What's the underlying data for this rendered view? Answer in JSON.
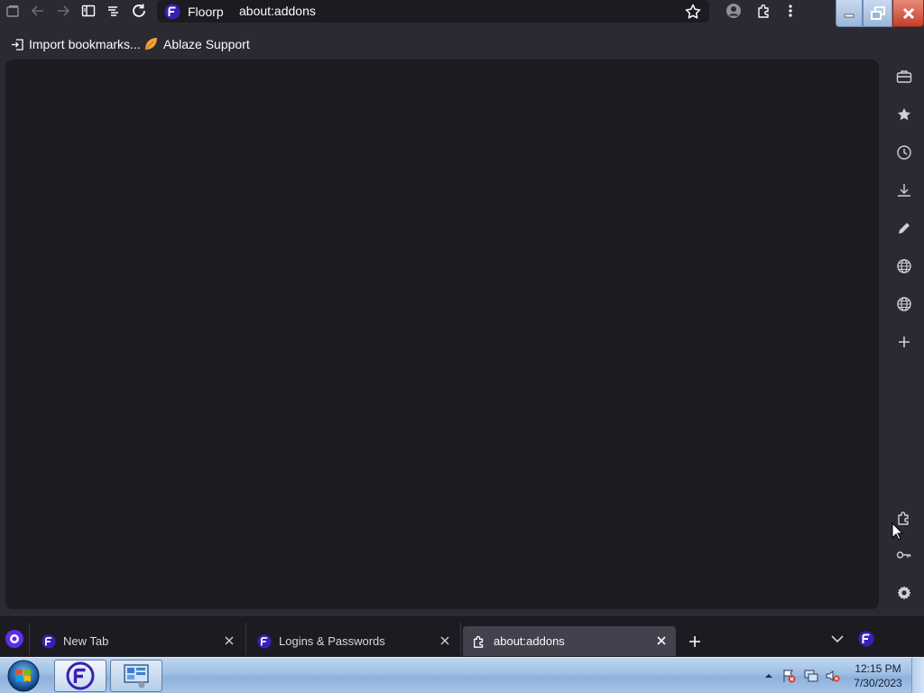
{
  "navbar": {
    "tab_manager_icon": "tab-manager-icon",
    "back_icon": "back-arrow-icon",
    "forward_icon": "forward-arrow-icon",
    "sidebar_icon": "sidebar-toggle-icon",
    "tree_icon": "tree-tabs-icon",
    "reload_icon": "reload-icon"
  },
  "urlbar": {
    "identity_label": "Floorp",
    "url": "about:addons",
    "bookmark_icon": "star-icon"
  },
  "toolbar_right": {
    "account_icon": "account-icon",
    "extensions_icon": "puzzle-icon",
    "menu_icon": "kebab-menu-icon"
  },
  "bookmarks": [
    {
      "label": "Import bookmarks...",
      "icon": "import-icon"
    },
    {
      "label": "Ablaze Support",
      "icon": "ablaze-leaf-icon"
    }
  ],
  "sidebar": {
    "items": [
      {
        "name": "toolbox-icon"
      },
      {
        "name": "bookmarks-star-icon"
      },
      {
        "name": "history-clock-icon"
      },
      {
        "name": "downloads-icon"
      },
      {
        "name": "notes-pencil-icon"
      },
      {
        "name": "web-panel-globe-icon"
      },
      {
        "name": "web-panel-globe-icon"
      },
      {
        "name": "add-panel-plus-icon"
      }
    ],
    "bottom_items": [
      {
        "name": "addons-puzzle-icon"
      },
      {
        "name": "passwords-key-icon"
      },
      {
        "name": "settings-gear-icon"
      }
    ]
  },
  "tabs": [
    {
      "label": "New Tab",
      "selected": false
    },
    {
      "label": "Logins & Passwords",
      "selected": false
    },
    {
      "label": "about:addons",
      "selected": true
    }
  ],
  "tabstrip": {
    "new_tab_icon": "plus-icon",
    "list_all_icon": "chevron-down-icon"
  },
  "taskbar": {
    "start_icon": "windows-start-orb",
    "apps": [
      "floorp-app-icon",
      "control-panel-icon"
    ],
    "tray": [
      "show-hidden-arrow-icon",
      "action-center-flag-icon",
      "network-icon",
      "volume-muted-icon"
    ],
    "time": "12:15 PM",
    "date": "7/30/2023"
  },
  "colors": {
    "toolbar_bg": "#2b2a33",
    "content_bg": "#1c1b22",
    "floorp_purple": "#5b2ee8",
    "selected_tab": "#42414d"
  }
}
